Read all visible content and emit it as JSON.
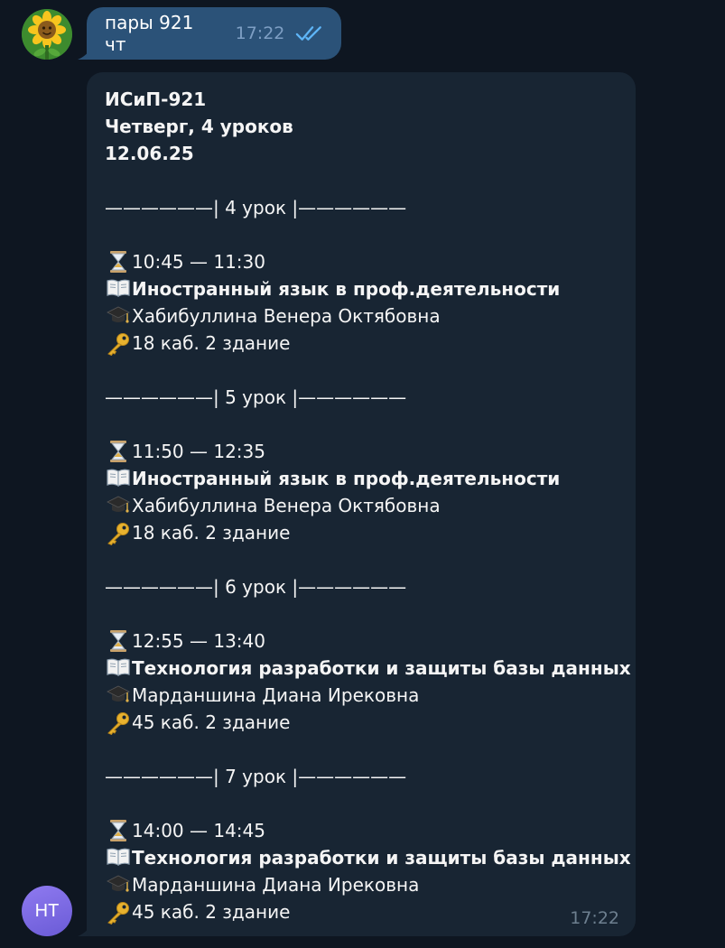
{
  "outgoing": {
    "text": "пары 921 чт",
    "time": "17:22",
    "status": "read"
  },
  "incoming": {
    "header": [
      "ИСиП-921",
      "Четверг, 4 уроков",
      "12.06.25"
    ],
    "lessons": [
      {
        "separator": "——————| 4 урок |——————",
        "time": "10:45 — 11:30",
        "subject": "Иностранный язык в проф.деятельности",
        "teacher": "Хабибуллина Венера Октябовна",
        "room": "18 каб. 2 здание"
      },
      {
        "separator": "——————| 5 урок |——————",
        "time": "11:50 — 12:35",
        "subject": "Иностранный язык в проф.деятельности",
        "teacher": "Хабибуллина Венера Октябовна",
        "room": "18 каб. 2 здание"
      },
      {
        "separator": "——————| 6 урок |——————",
        "time": "12:55 — 13:40",
        "subject": "Технология разработки и защиты базы данных",
        "teacher": "Марданшина Диана Ирековна",
        "room": "45 каб. 2 здание"
      },
      {
        "separator": "——————| 7 урок |——————",
        "time": "14:00 — 14:45",
        "subject": "Технология разработки и защиты базы данных",
        "teacher": "Марданшина Диана Ирековна",
        "room": "45 каб. 2 здание"
      }
    ],
    "time": "17:22"
  },
  "sender_avatar": {
    "initials": "НТ",
    "color": "#7b6ae6"
  },
  "icons": {
    "time": "hourglass-icon",
    "subject": "book-icon",
    "teacher": "graduation-cap-icon",
    "room": "key-icon"
  },
  "colors": {
    "background": "#0e1621",
    "outgoing_bubble": "#2b5278",
    "incoming_bubble": "#182533",
    "check": "#5eb5f7"
  }
}
